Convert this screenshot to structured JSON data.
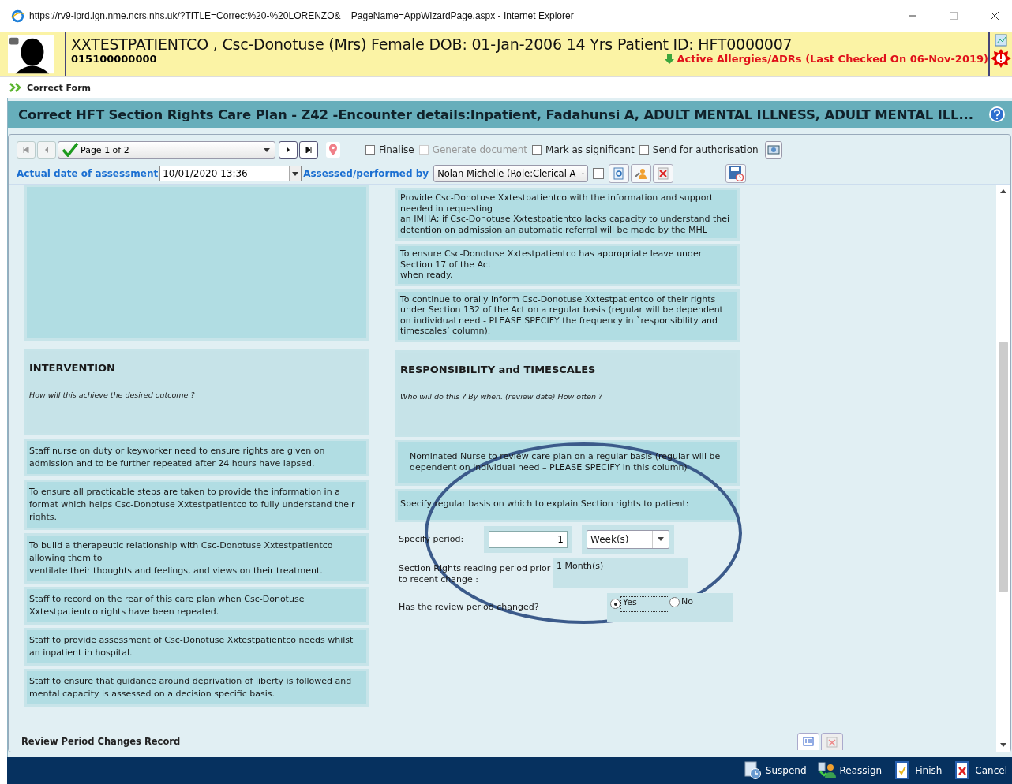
{
  "window": {
    "title": "https://rv9-lprd.lgn.nme.ncrs.nhs.uk/?TITLE=Correct%20-%20LORENZO&__PageName=AppWizardPage.aspx - Internet Explorer"
  },
  "patient_banner": {
    "name_line": "XXTESTPATIENTCO , Csc-Donotuse (Mrs) Female DOB: 01-Jan-2006 14 Yrs Patient ID: HFT0000007",
    "number": "015100000000",
    "allergies": "Active Allergies/ADRs (Last Checked On 06-Nov-2019)"
  },
  "breadcrumb": "Correct Form",
  "form_title": "Correct HFT Section Rights Care Plan - Z42 -Encounter details:Inpatient, Fadahunsi A, ADULT MENTAL ILLNESS, ADULT MENTAL ILL...",
  "toolbar": {
    "page": "Page 1 of 2",
    "options": [
      {
        "label": "Finalise",
        "checked": false,
        "disabled": false
      },
      {
        "label": "Generate document",
        "checked": false,
        "disabled": true
      },
      {
        "label": "Mark as significant",
        "checked": false,
        "disabled": false
      },
      {
        "label": "Send for authorisation",
        "checked": false,
        "disabled": false
      }
    ]
  },
  "assessment": {
    "date_label": "Actual date of assessment",
    "date_value": "10/01/2020 13:36",
    "performer_label": "Assessed/performed by",
    "performer_value": "Nolan Michelle (Role:Clerical A",
    "performer_checked": false
  },
  "left_column": {
    "intervention": {
      "heading": "INTERVENTION",
      "hint": "How will this achieve the desired outcome ?"
    },
    "items": [
      "Staff nurse on duty or keyworker need to ensure rights are given on admission and to be further repeated after 24 hours have lapsed.",
      "To ensure all practicable steps are taken to provide the information in a format which helps Csc-Donotuse Xxtestpatientco to fully understand their rights.",
      "To build a therapeutic relationship with Csc-Donotuse Xxtestpatientco allowing them to\nventilate their thoughts and feelings, and views on their treatment.",
      "Staff to record on the rear of this care plan when Csc-Donotuse Xxtestpatientco rights have been repeated.",
      "Staff to provide assessment of Csc-Donotuse Xxtestpatientco needs whilst an inpatient in hospital.",
      "Staff to ensure that guidance around deprivation of liberty is followed and mental capacity is assessed on a decision specific basis."
    ]
  },
  "right_column": {
    "items": [
      "Provide Csc-Donotuse Xxtestpatientco with the information and support needed in requesting\nan IMHA; if Csc-Donotuse Xxtestpatientco lacks capacity to understand thei\ndetention on admission an automatic referral will be made by the MHL",
      "To ensure Csc-Donotuse Xxtestpatientco has appropriate leave under Section 17 of the Act\nwhen ready.",
      "To continue to orally inform Csc-Donotuse Xxtestpatientco of their rights under Section 132 of the Act on a regular basis (regular will be dependent on individual need - PLEASE SPECIFY the frequency in `responsibility and timescales’ column)."
    ],
    "responsibility": {
      "heading": "RESPONSIBILITY and TIMESCALES",
      "hint": "Who will do this ? By when. (review date) How often ?"
    },
    "nominated": "Nominated Nurse to review care plan on a regular basis (regular will be dependent on individual need – PLEASE SPECIFY in this column)",
    "specify": "Specify regular basis on which to explain Section rights to patient:",
    "period_label": "Specify period:",
    "period_value": "1",
    "period_unit": "Week(s)",
    "prior_label": "Section Rights reading period prior to recent change :",
    "prior_value": "1 Month(s)",
    "changed_label": "Has the review period changed?",
    "changed_options": [
      {
        "label": "Yes",
        "selected": true
      },
      {
        "label": "No",
        "selected": false
      }
    ]
  },
  "record_heading": "Review Period Changes Record",
  "actions": [
    {
      "kind": "suspend",
      "label": "Suspend"
    },
    {
      "kind": "reassign",
      "label": "Reassign"
    },
    {
      "kind": "finish",
      "label": "Finish"
    },
    {
      "kind": "cancel",
      "label": "Cancel"
    }
  ]
}
